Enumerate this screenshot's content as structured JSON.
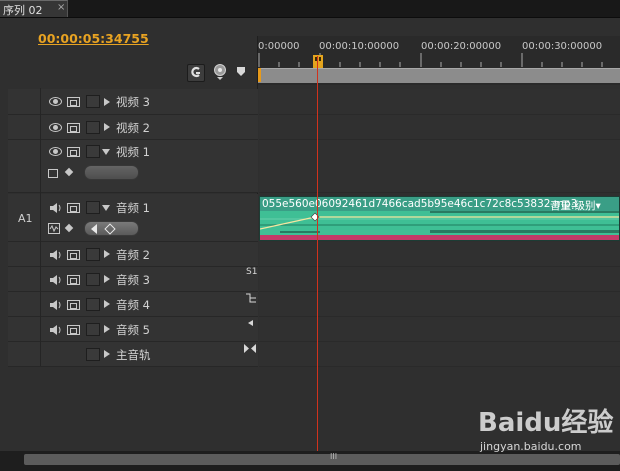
{
  "tab": {
    "label": "序列 02",
    "close": "×"
  },
  "timecode": "00:00:05:34755",
  "ruler": {
    "ticks": [
      "0:00000",
      "00:00:10:00000",
      "00:00:20:00000",
      "00:00:30:00000"
    ]
  },
  "tools": {
    "snap_icon": "snap-magnet-icon",
    "marker_icon": "marker-icon",
    "keyframe_icon": "keyframe-icon"
  },
  "tracks": [
    {
      "label": "视频 3",
      "type": "video",
      "expanded": false
    },
    {
      "label": "视频 2",
      "type": "video",
      "expanded": false
    },
    {
      "label": "视频 1",
      "type": "video",
      "expanded": true
    },
    {
      "label": "音频 1",
      "type": "audio",
      "expanded": true,
      "target": "A1"
    },
    {
      "label": "音频 2",
      "type": "audio",
      "expanded": false
    },
    {
      "label": "音频 3",
      "type": "audio",
      "expanded": false,
      "side": "S1"
    },
    {
      "label": "音频 4",
      "type": "audio",
      "expanded": false
    },
    {
      "label": "音频 5",
      "type": "audio",
      "expanded": false
    },
    {
      "label": "主音轨",
      "type": "master",
      "expanded": false
    }
  ],
  "clip": {
    "name": "055e560e06092461d7466cad5b95e46c1c72c8c53832.mp3",
    "param": "音量:级别",
    "param_arrow": "▾"
  },
  "scroll_label": "III",
  "watermark": {
    "brand": "Baidu经验",
    "url": "jingyan.baidu.com"
  },
  "colors": {
    "timecode": "#e8a322",
    "playhead": "#d0321d",
    "clip": "#3a9e86",
    "clip_bottom": "#c23a68"
  }
}
